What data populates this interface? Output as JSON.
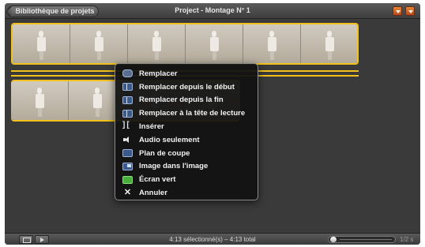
{
  "titlebar": {
    "library_button": "Bibliothèque de projets",
    "title": "Project - Montage N° 1"
  },
  "menu": {
    "items": [
      {
        "label": "Remplacer",
        "icon": "replace-icon"
      },
      {
        "label": "Remplacer depuis le début",
        "icon": "replace-from-start-icon"
      },
      {
        "label": "Remplacer depuis la fin",
        "icon": "replace-from-end-icon"
      },
      {
        "label": "Remplacer à la tête de lecture",
        "icon": "replace-at-playhead-icon"
      },
      {
        "label": "Insérer",
        "icon": "insert-icon"
      },
      {
        "label": "Audio seulement",
        "icon": "speaker-icon"
      },
      {
        "label": "Plan de coupe",
        "icon": "cutaway-icon"
      },
      {
        "label": "Image dans l'image",
        "icon": "picture-in-picture-icon"
      },
      {
        "label": "Écran vert",
        "icon": "green-screen-icon"
      },
      {
        "label": "Annuler",
        "icon": "cancel-x-icon"
      }
    ]
  },
  "bottombar": {
    "status": "4:13 sélectionné(s) – 4:13 total",
    "zoom_label": "1/2 s"
  },
  "colors": {
    "selection": "#f2c11c",
    "titlebar_accent": "#d9692b",
    "green_screen": "#47b03a"
  }
}
